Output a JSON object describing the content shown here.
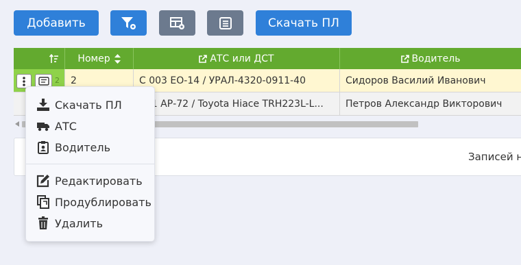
{
  "toolbar": {
    "add_label": "Добавить",
    "download_label": "Скачать ПЛ"
  },
  "columns": {
    "number": "Номер",
    "vehicle": "АТС или ДСТ",
    "driver": "Водитель"
  },
  "rows": [
    {
      "num": "2",
      "vehicle": "С 003 ЕО-14 / УРАЛ-4320-0911-40",
      "driver": "Сидоров Василий Иванович",
      "row_index": "2"
    },
    {
      "num": "",
      "vehicle": "001 АР-72 / Toyota Hiace TRH223L-L...",
      "driver": "Петров Александр Викторович"
    }
  ],
  "footer": {
    "records_text": "Записей н"
  },
  "context_menu": {
    "items": [
      {
        "label": "Скачать ПЛ",
        "icon": "download-icon"
      },
      {
        "label": "АТС",
        "icon": "truck-icon"
      },
      {
        "label": "Водитель",
        "icon": "badge-icon"
      },
      {
        "label": "Редактировать",
        "icon": "edit-icon"
      },
      {
        "label": "Продублировать",
        "icon": "duplicate-icon"
      },
      {
        "label": "Удалить",
        "icon": "trash-icon"
      }
    ]
  },
  "colors": {
    "header_green": "#63aa2f",
    "button_blue": "#2f80d9",
    "button_gray": "#6c7a8e",
    "selected_row": "#fff7d1"
  }
}
